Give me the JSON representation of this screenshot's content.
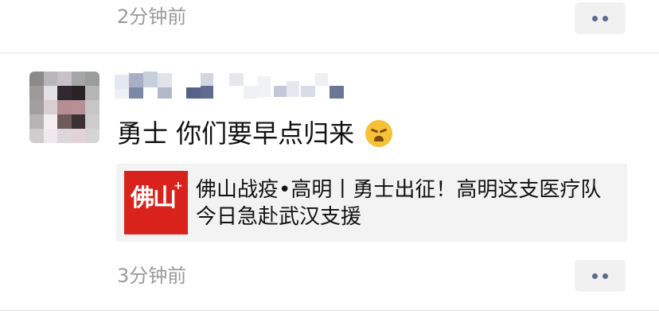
{
  "previous_comment": {
    "time": "2分钟前"
  },
  "comment": {
    "text": "勇士 你们要早点归来",
    "emoji_icon": "crying-laughing-emoji-icon",
    "link": {
      "thumb_text": "佛山",
      "thumb_plus": "+",
      "title": "佛山战疫•高明丨勇士出征！高明这支医疗队今日急赴武汉支援"
    },
    "time": "3分钟前"
  },
  "colors": {
    "time": "#9a9a9a",
    "more_dots": "#5b6a91",
    "link_card_bg": "#f3f3f3",
    "thumb_bg": "#d9221c"
  }
}
